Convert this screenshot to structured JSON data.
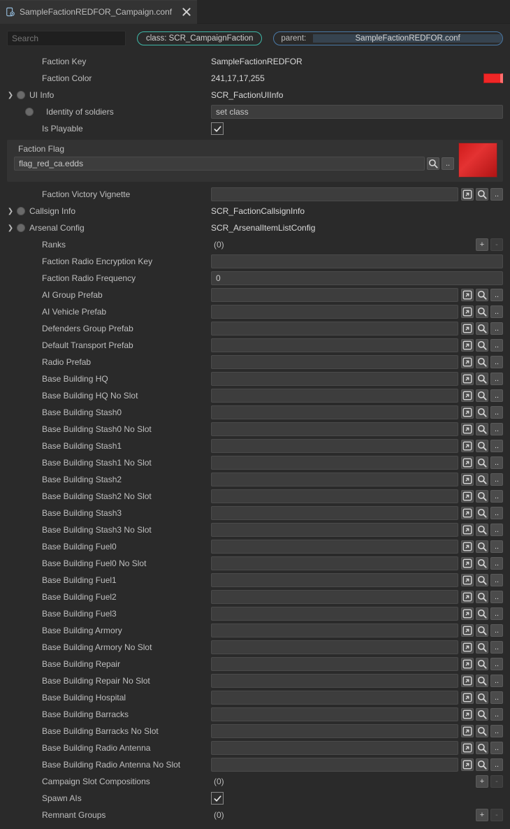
{
  "tab": {
    "title": "SampleFactionREDFOR_Campaign.conf"
  },
  "header": {
    "search_placeholder": "Search",
    "class_pill": "class: SCR_CampaignFaction",
    "parent_label": "parent:",
    "parent_value": "SampleFactionREDFOR.conf"
  },
  "factionFlag": {
    "label": "Faction Flag",
    "value": "flag_red_ca.edds"
  },
  "rows": [
    {
      "k": "faction-key",
      "label": "Faction Key",
      "chev": false,
      "dot": false,
      "indent": 0,
      "type": "text",
      "value": "SampleFactionREDFOR"
    },
    {
      "k": "faction-color",
      "label": "Faction Color",
      "chev": false,
      "dot": false,
      "indent": 0,
      "type": "color",
      "value": "241,17,17,255"
    },
    {
      "k": "ui-info",
      "label": "UI Info",
      "chev": true,
      "dot": true,
      "indent": 0,
      "type": "text",
      "value": "SCR_FactionUIInfo"
    },
    {
      "k": "identity-of-soldiers",
      "label": "Identity of soldiers",
      "chev": false,
      "dot": true,
      "indent": 1,
      "type": "inputBtn",
      "value": "set class"
    },
    {
      "k": "is-playable",
      "label": "Is Playable",
      "chev": false,
      "dot": false,
      "indent": 0,
      "type": "check",
      "checked": true
    },
    {
      "k": "__flagblock__"
    },
    {
      "k": "faction-victory-vignette",
      "label": "Faction Victory Vignette",
      "chev": false,
      "dot": false,
      "indent": 0,
      "type": "asset"
    },
    {
      "k": "callsign-info",
      "label": "Callsign Info",
      "chev": true,
      "dot": true,
      "indent": 0,
      "type": "text",
      "value": "SCR_FactionCallsignInfo"
    },
    {
      "k": "arsenal-config",
      "label": "Arsenal Config",
      "chev": true,
      "dot": true,
      "indent": 0,
      "type": "text",
      "value": "SCR_ArsenalItemListConfig"
    },
    {
      "k": "ranks",
      "label": "Ranks",
      "chev": false,
      "dot": false,
      "indent": 0,
      "type": "array",
      "count": "(0)"
    },
    {
      "k": "faction-radio-encryption-key",
      "label": "Faction Radio Encryption Key",
      "chev": false,
      "dot": false,
      "indent": 0,
      "type": "input",
      "value": ""
    },
    {
      "k": "faction-radio-frequency",
      "label": "Faction Radio Frequency",
      "chev": false,
      "dot": false,
      "indent": 0,
      "type": "input",
      "value": "0"
    },
    {
      "k": "ai-group-prefab",
      "label": "AI Group Prefab",
      "chev": false,
      "dot": false,
      "indent": 0,
      "type": "asset"
    },
    {
      "k": "ai-vehicle-prefab",
      "label": "AI Vehicle Prefab",
      "chev": false,
      "dot": false,
      "indent": 0,
      "type": "asset"
    },
    {
      "k": "defenders-group-prefab",
      "label": "Defenders Group Prefab",
      "chev": false,
      "dot": false,
      "indent": 0,
      "type": "asset"
    },
    {
      "k": "default-transport-prefab",
      "label": "Default Transport Prefab",
      "chev": false,
      "dot": false,
      "indent": 0,
      "type": "asset"
    },
    {
      "k": "radio-prefab",
      "label": "Radio Prefab",
      "chev": false,
      "dot": false,
      "indent": 0,
      "type": "asset"
    },
    {
      "k": "base-building-hq",
      "label": "Base Building HQ",
      "chev": false,
      "dot": false,
      "indent": 0,
      "type": "asset"
    },
    {
      "k": "base-building-hq-no-slot",
      "label": "Base Building HQ No Slot",
      "chev": false,
      "dot": false,
      "indent": 0,
      "type": "asset"
    },
    {
      "k": "base-building-stash0",
      "label": "Base Building Stash0",
      "chev": false,
      "dot": false,
      "indent": 0,
      "type": "asset"
    },
    {
      "k": "base-building-stash0-no-slot",
      "label": "Base Building Stash0 No Slot",
      "chev": false,
      "dot": false,
      "indent": 0,
      "type": "asset"
    },
    {
      "k": "base-building-stash1",
      "label": "Base Building Stash1",
      "chev": false,
      "dot": false,
      "indent": 0,
      "type": "asset"
    },
    {
      "k": "base-building-stash1-no-slot",
      "label": "Base Building Stash1 No Slot",
      "chev": false,
      "dot": false,
      "indent": 0,
      "type": "asset"
    },
    {
      "k": "base-building-stash2",
      "label": "Base Building Stash2",
      "chev": false,
      "dot": false,
      "indent": 0,
      "type": "asset"
    },
    {
      "k": "base-building-stash2-no-slot",
      "label": "Base Building Stash2 No Slot",
      "chev": false,
      "dot": false,
      "indent": 0,
      "type": "asset"
    },
    {
      "k": "base-building-stash3",
      "label": "Base Building Stash3",
      "chev": false,
      "dot": false,
      "indent": 0,
      "type": "asset"
    },
    {
      "k": "base-building-stash3-no-slot",
      "label": "Base Building Stash3 No Slot",
      "chev": false,
      "dot": false,
      "indent": 0,
      "type": "asset"
    },
    {
      "k": "base-building-fuel0",
      "label": "Base Building Fuel0",
      "chev": false,
      "dot": false,
      "indent": 0,
      "type": "asset"
    },
    {
      "k": "base-building-fuel0-no-slot",
      "label": "Base Building Fuel0 No Slot",
      "chev": false,
      "dot": false,
      "indent": 0,
      "type": "asset"
    },
    {
      "k": "base-building-fuel1",
      "label": "Base Building Fuel1",
      "chev": false,
      "dot": false,
      "indent": 0,
      "type": "asset"
    },
    {
      "k": "base-building-fuel2",
      "label": "Base Building Fuel2",
      "chev": false,
      "dot": false,
      "indent": 0,
      "type": "asset"
    },
    {
      "k": "base-building-fuel3",
      "label": "Base Building Fuel3",
      "chev": false,
      "dot": false,
      "indent": 0,
      "type": "asset"
    },
    {
      "k": "base-building-armory",
      "label": "Base Building Armory",
      "chev": false,
      "dot": false,
      "indent": 0,
      "type": "asset"
    },
    {
      "k": "base-building-armory-no-slot",
      "label": "Base Building Armory No Slot",
      "chev": false,
      "dot": false,
      "indent": 0,
      "type": "asset"
    },
    {
      "k": "base-building-repair",
      "label": "Base Building Repair",
      "chev": false,
      "dot": false,
      "indent": 0,
      "type": "asset"
    },
    {
      "k": "base-building-repair-no-slot",
      "label": "Base Building Repair No Slot",
      "chev": false,
      "dot": false,
      "indent": 0,
      "type": "asset"
    },
    {
      "k": "base-building-hospital",
      "label": "Base Building Hospital",
      "chev": false,
      "dot": false,
      "indent": 0,
      "type": "asset"
    },
    {
      "k": "base-building-barracks",
      "label": "Base Building Barracks",
      "chev": false,
      "dot": false,
      "indent": 0,
      "type": "asset"
    },
    {
      "k": "base-building-barracks-no-slot",
      "label": "Base Building Barracks No Slot",
      "chev": false,
      "dot": false,
      "indent": 0,
      "type": "asset"
    },
    {
      "k": "base-building-radio-antenna",
      "label": "Base Building Radio Antenna",
      "chev": false,
      "dot": false,
      "indent": 0,
      "type": "asset"
    },
    {
      "k": "base-building-radio-antenna-no-slot",
      "label": "Base Building Radio Antenna No Slot",
      "chev": false,
      "dot": false,
      "indent": 0,
      "type": "asset"
    },
    {
      "k": "campaign-slot-compositions",
      "label": "Campaign Slot Compositions",
      "chev": false,
      "dot": false,
      "indent": 0,
      "type": "array",
      "count": "(0)"
    },
    {
      "k": "spawn-ais",
      "label": "Spawn AIs",
      "chev": false,
      "dot": false,
      "indent": 0,
      "type": "check",
      "checked": true
    },
    {
      "k": "remnant-groups",
      "label": "Remnant Groups",
      "chev": false,
      "dot": false,
      "indent": 0,
      "type": "array",
      "count": "(0)"
    }
  ]
}
